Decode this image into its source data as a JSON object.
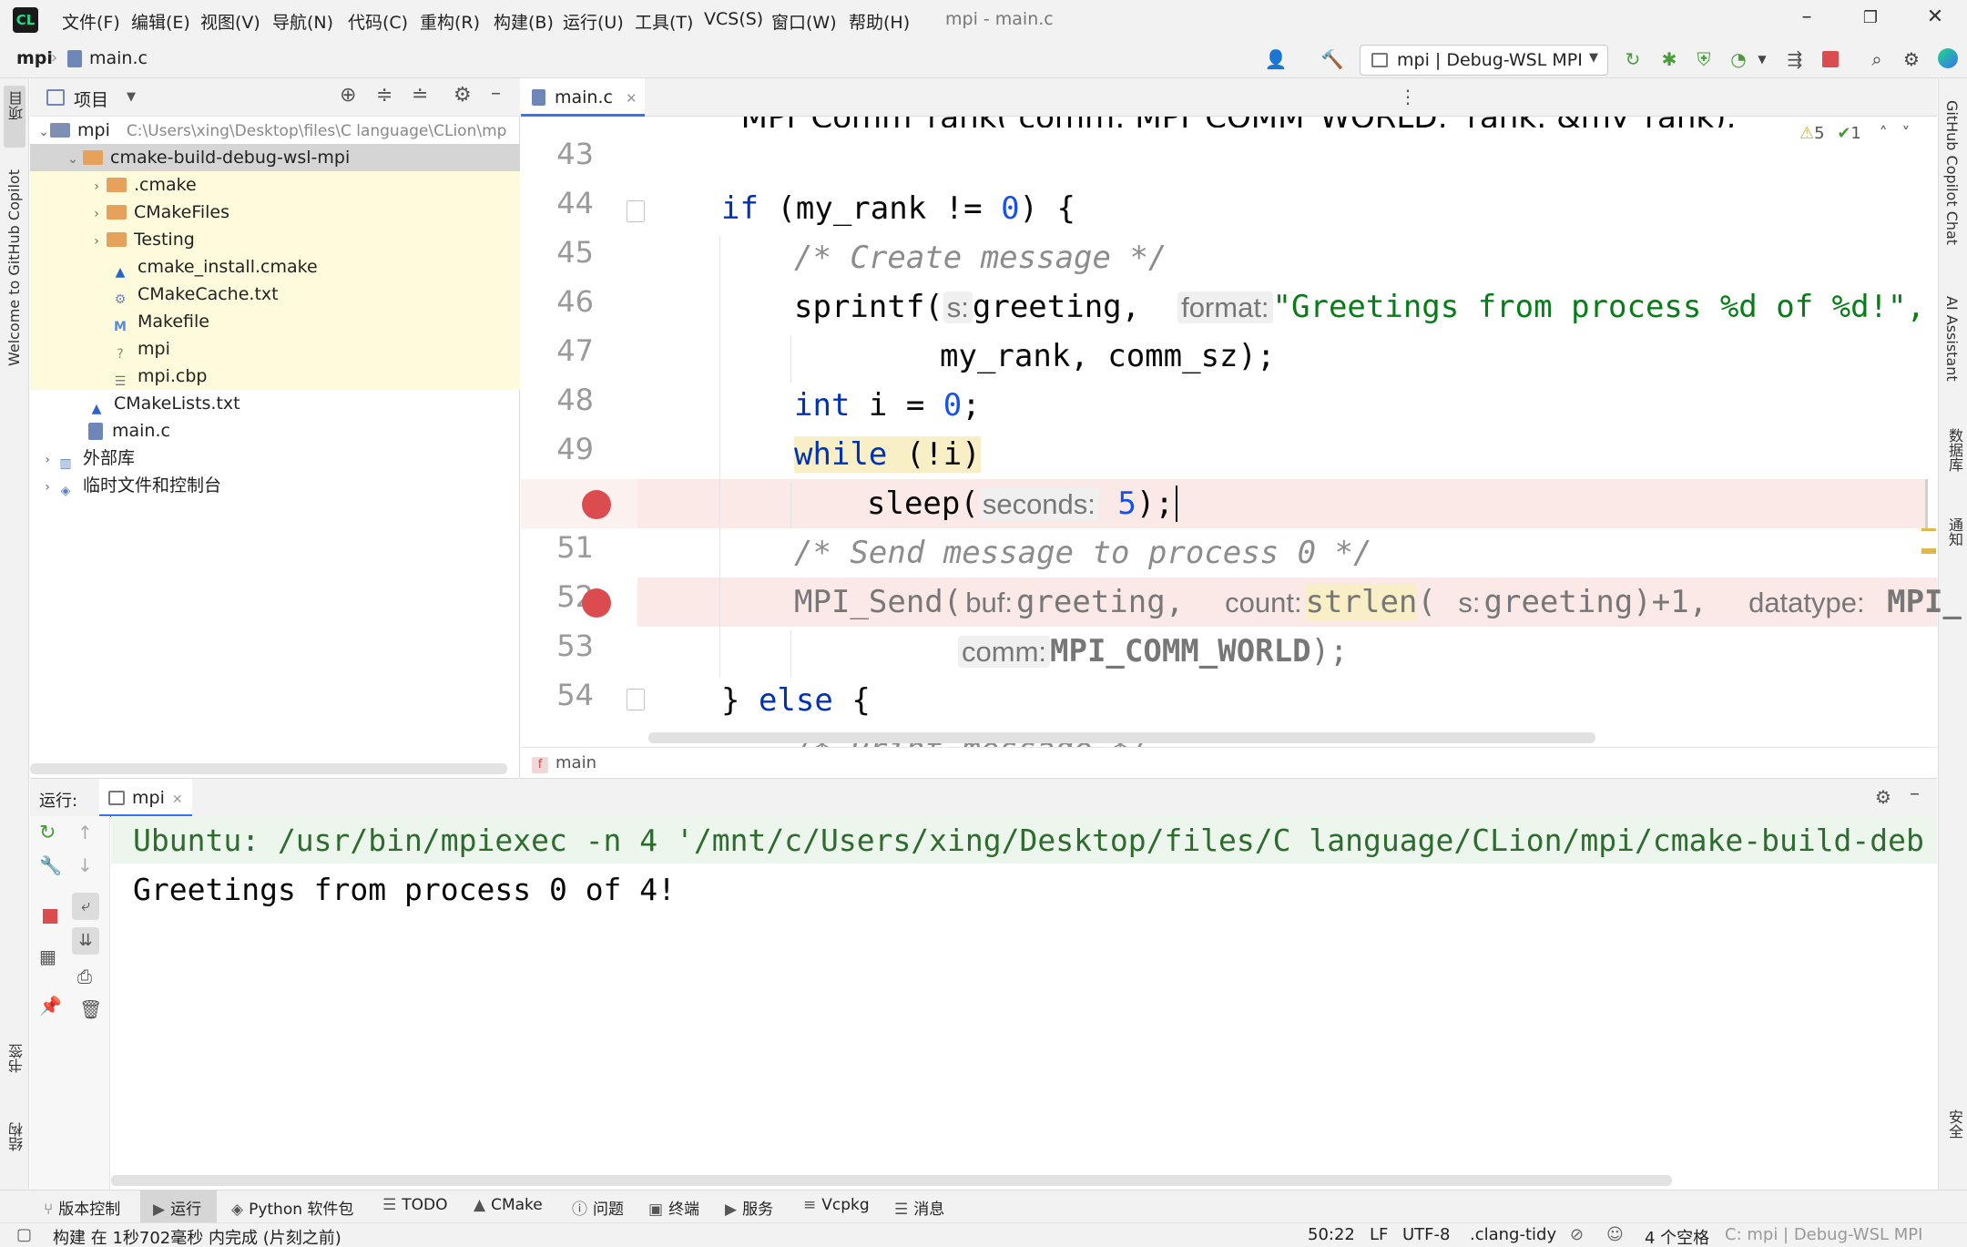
{
  "app": {
    "window_title": "mpi - main.c"
  },
  "menu": [
    "文件(F)",
    "编辑(E)",
    "视图(V)",
    "导航(N)",
    "代码(C)",
    "重构(R)",
    "构建(B)",
    "运行(U)",
    "工具(T)",
    "VCS(S)",
    "窗口(W)",
    "帮助(H)"
  ],
  "nav": {
    "project": "mpi",
    "file": "main.c"
  },
  "run_config": "mpi | Debug-WSL MPI",
  "left_strip": {
    "project": "项目",
    "copilot": "Welcome to GitHub Copilot",
    "bookmarks": "书签",
    "structure": "结构"
  },
  "right_strip": {
    "copilot_chat": "GitHub Copilot Chat",
    "ai": "AI Assistant",
    "db": "数据库",
    "notify": "通知",
    "sec": "安全"
  },
  "project_panel": {
    "title": "项目",
    "rows": [
      {
        "name": "mpi",
        "path": "C:\\Users\\xing\\Desktop\\files\\C language\\CLion\\mp"
      },
      {
        "name": "cmake-build-debug-wsl-mpi"
      },
      {
        "name": ".cmake"
      },
      {
        "name": "CMakeFiles"
      },
      {
        "name": "Testing"
      },
      {
        "name": "cmake_install.cmake"
      },
      {
        "name": "CMakeCache.txt"
      },
      {
        "name": "Makefile"
      },
      {
        "name": "mpi"
      },
      {
        "name": "mpi.cbp"
      },
      {
        "name": "CMakeLists.txt"
      },
      {
        "name": "main.c"
      },
      {
        "name": "外部库"
      },
      {
        "name": "临时文件和控制台"
      }
    ]
  },
  "editor": {
    "tab": "main.c",
    "inspections": {
      "warnings": "5",
      "ok": "1"
    },
    "top_partial_line": "MPI_Comm_rank( comm: MPI_COMM_WORLD,  rank: &my_rank);",
    "lines": {
      "n43": "43",
      "n44": "44",
      "n45": "45",
      "n46": "46",
      "n47": "47",
      "n48": "48",
      "n49": "49",
      "n50": "50",
      "n51": "51",
      "n52": "52",
      "n53": "53",
      "n54": "54"
    },
    "code": {
      "if_kw": "if",
      "if_rest": " (my_rank != ",
      "zero": "0",
      "if_end": ") {",
      "c45": "/* Create message */",
      "sprintf": "sprintf(",
      "hint_s": "s:",
      "greeting": "greeting, ",
      "hint_format": "format:",
      "fmt_str": "\"Greetings from process %d of %d!\",",
      "c47": "my_rank, comm_sz);",
      "int_kw": "int",
      "int_rest": " i = ",
      "int_end": ";",
      "while_kw": "while",
      "while_rest": " (!i)",
      "sleep": "sleep(",
      "hint_seconds": "seconds:",
      "five": "5",
      "sleep_end": ");",
      "c51": "/* Send message to process 0 */",
      "send": "MPI_Send(",
      "hint_buf": "buf:",
      "buf_val": "greeting,  ",
      "hint_count": "count:",
      "strlen": "strlen",
      "strlen_open": "(",
      "strlen_rest": "greeting)+1,  ",
      "hint_datatype": "datatype:",
      "dtype": "MPI_",
      "hint_comm": "comm:",
      "comm_val": "MPI_COMM_WORLD",
      "comm_end": ");",
      "else_open": "} ",
      "else_kw": "else",
      "else_end": " {",
      "bottom_partial": "/* Print message */"
    },
    "breadcrumb": "main"
  },
  "run": {
    "label": "运行:",
    "tab": "mpi",
    "console": [
      "Ubuntu: /usr/bin/mpiexec -n 4 '/mnt/c/Users/xing/Desktop/files/C language/CLion/mpi/cmake-build-deb",
      "Greetings from process 0 of 4!"
    ]
  },
  "tool_windows": [
    "版本控制",
    "运行",
    "Python 软件包",
    "TODO",
    "CMake",
    "问题",
    "终端",
    "服务",
    "Vcpkg",
    "消息"
  ],
  "status": {
    "message": "构建 在 1秒702毫秒 内完成 (片刻之前)",
    "position": "50:22",
    "line_sep": "LF",
    "encoding": "UTF-8",
    "tidy": ".clang-tidy",
    "indent": "4 个空格",
    "context": "C: mpi | Debug-WSL MPI"
  },
  "colors": {
    "accent": "#3574f0",
    "breakpoint": "#db4c4e",
    "keyword": "#0033b3",
    "string": "#067d17",
    "comment": "#8c8c8c"
  }
}
